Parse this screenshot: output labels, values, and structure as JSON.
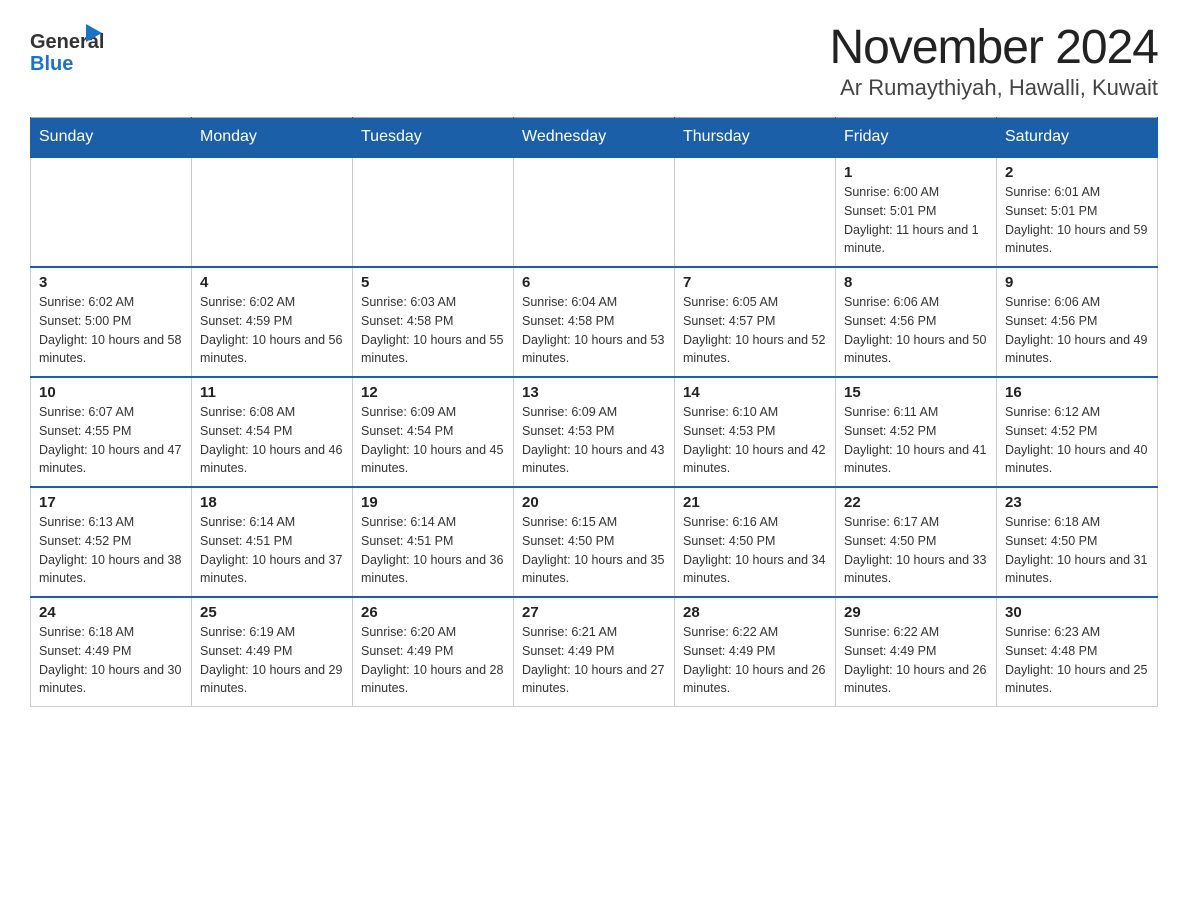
{
  "header": {
    "logo_general": "General",
    "logo_blue": "Blue",
    "month_title": "November 2024",
    "location": "Ar Rumaythiyah, Hawalli, Kuwait"
  },
  "weekdays": [
    "Sunday",
    "Monday",
    "Tuesday",
    "Wednesday",
    "Thursday",
    "Friday",
    "Saturday"
  ],
  "weeks": [
    [
      {
        "day": "",
        "info": ""
      },
      {
        "day": "",
        "info": ""
      },
      {
        "day": "",
        "info": ""
      },
      {
        "day": "",
        "info": ""
      },
      {
        "day": "",
        "info": ""
      },
      {
        "day": "1",
        "info": "Sunrise: 6:00 AM\nSunset: 5:01 PM\nDaylight: 11 hours and 1 minute."
      },
      {
        "day": "2",
        "info": "Sunrise: 6:01 AM\nSunset: 5:01 PM\nDaylight: 10 hours and 59 minutes."
      }
    ],
    [
      {
        "day": "3",
        "info": "Sunrise: 6:02 AM\nSunset: 5:00 PM\nDaylight: 10 hours and 58 minutes."
      },
      {
        "day": "4",
        "info": "Sunrise: 6:02 AM\nSunset: 4:59 PM\nDaylight: 10 hours and 56 minutes."
      },
      {
        "day": "5",
        "info": "Sunrise: 6:03 AM\nSunset: 4:58 PM\nDaylight: 10 hours and 55 minutes."
      },
      {
        "day": "6",
        "info": "Sunrise: 6:04 AM\nSunset: 4:58 PM\nDaylight: 10 hours and 53 minutes."
      },
      {
        "day": "7",
        "info": "Sunrise: 6:05 AM\nSunset: 4:57 PM\nDaylight: 10 hours and 52 minutes."
      },
      {
        "day": "8",
        "info": "Sunrise: 6:06 AM\nSunset: 4:56 PM\nDaylight: 10 hours and 50 minutes."
      },
      {
        "day": "9",
        "info": "Sunrise: 6:06 AM\nSunset: 4:56 PM\nDaylight: 10 hours and 49 minutes."
      }
    ],
    [
      {
        "day": "10",
        "info": "Sunrise: 6:07 AM\nSunset: 4:55 PM\nDaylight: 10 hours and 47 minutes."
      },
      {
        "day": "11",
        "info": "Sunrise: 6:08 AM\nSunset: 4:54 PM\nDaylight: 10 hours and 46 minutes."
      },
      {
        "day": "12",
        "info": "Sunrise: 6:09 AM\nSunset: 4:54 PM\nDaylight: 10 hours and 45 minutes."
      },
      {
        "day": "13",
        "info": "Sunrise: 6:09 AM\nSunset: 4:53 PM\nDaylight: 10 hours and 43 minutes."
      },
      {
        "day": "14",
        "info": "Sunrise: 6:10 AM\nSunset: 4:53 PM\nDaylight: 10 hours and 42 minutes."
      },
      {
        "day": "15",
        "info": "Sunrise: 6:11 AM\nSunset: 4:52 PM\nDaylight: 10 hours and 41 minutes."
      },
      {
        "day": "16",
        "info": "Sunrise: 6:12 AM\nSunset: 4:52 PM\nDaylight: 10 hours and 40 minutes."
      }
    ],
    [
      {
        "day": "17",
        "info": "Sunrise: 6:13 AM\nSunset: 4:52 PM\nDaylight: 10 hours and 38 minutes."
      },
      {
        "day": "18",
        "info": "Sunrise: 6:14 AM\nSunset: 4:51 PM\nDaylight: 10 hours and 37 minutes."
      },
      {
        "day": "19",
        "info": "Sunrise: 6:14 AM\nSunset: 4:51 PM\nDaylight: 10 hours and 36 minutes."
      },
      {
        "day": "20",
        "info": "Sunrise: 6:15 AM\nSunset: 4:50 PM\nDaylight: 10 hours and 35 minutes."
      },
      {
        "day": "21",
        "info": "Sunrise: 6:16 AM\nSunset: 4:50 PM\nDaylight: 10 hours and 34 minutes."
      },
      {
        "day": "22",
        "info": "Sunrise: 6:17 AM\nSunset: 4:50 PM\nDaylight: 10 hours and 33 minutes."
      },
      {
        "day": "23",
        "info": "Sunrise: 6:18 AM\nSunset: 4:50 PM\nDaylight: 10 hours and 31 minutes."
      }
    ],
    [
      {
        "day": "24",
        "info": "Sunrise: 6:18 AM\nSunset: 4:49 PM\nDaylight: 10 hours and 30 minutes."
      },
      {
        "day": "25",
        "info": "Sunrise: 6:19 AM\nSunset: 4:49 PM\nDaylight: 10 hours and 29 minutes."
      },
      {
        "day": "26",
        "info": "Sunrise: 6:20 AM\nSunset: 4:49 PM\nDaylight: 10 hours and 28 minutes."
      },
      {
        "day": "27",
        "info": "Sunrise: 6:21 AM\nSunset: 4:49 PM\nDaylight: 10 hours and 27 minutes."
      },
      {
        "day": "28",
        "info": "Sunrise: 6:22 AM\nSunset: 4:49 PM\nDaylight: 10 hours and 26 minutes."
      },
      {
        "day": "29",
        "info": "Sunrise: 6:22 AM\nSunset: 4:49 PM\nDaylight: 10 hours and 26 minutes."
      },
      {
        "day": "30",
        "info": "Sunrise: 6:23 AM\nSunset: 4:48 PM\nDaylight: 10 hours and 25 minutes."
      }
    ]
  ]
}
